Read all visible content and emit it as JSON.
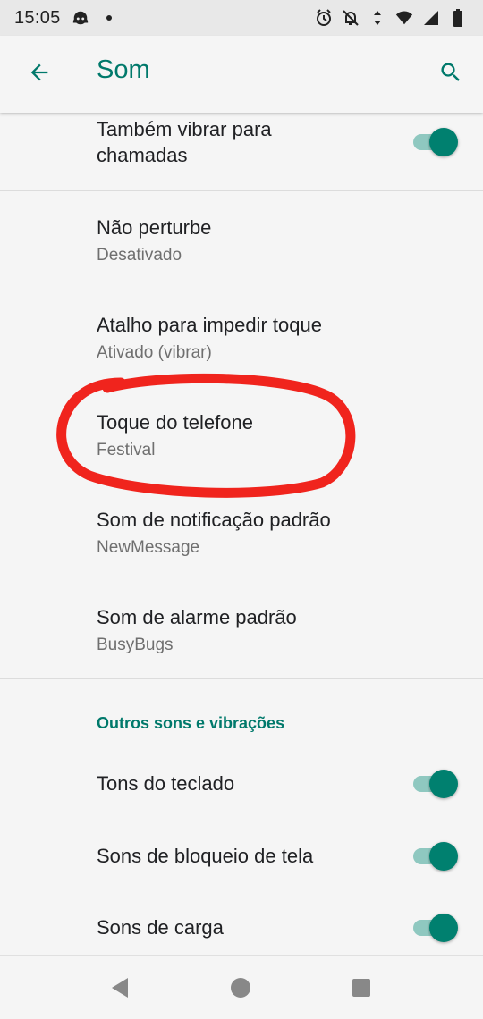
{
  "status_bar": {
    "time": "15:05",
    "icons": [
      "android-head-icon",
      "dot-icon",
      "alarm-icon",
      "notifications-off-icon",
      "data-arrows-icon",
      "wifi-icon",
      "signal-icon",
      "battery-icon"
    ]
  },
  "app_bar": {
    "title": "Som",
    "back_icon": "arrow-left-icon",
    "search_icon": "search-icon"
  },
  "settings": {
    "vibrate_calls": {
      "title_line1": "Também vibrar para",
      "title_line2": "chamadas",
      "enabled": true
    },
    "dnd": {
      "title": "Não perturbe",
      "subtitle": "Desativado"
    },
    "ring_shortcut": {
      "title": "Atalho para impedir toque",
      "subtitle": "Ativado (vibrar)"
    },
    "ringtone": {
      "title": "Toque do telefone",
      "subtitle": "Festival"
    },
    "notification_sound": {
      "title": "Som de notificação padrão",
      "subtitle": "NewMessage"
    },
    "alarm_sound": {
      "title": "Som de alarme padrão",
      "subtitle": "BusyBugs"
    }
  },
  "other_section": {
    "header": "Outros sons e vibrações",
    "items": [
      {
        "title": "Tons do teclado",
        "enabled": true
      },
      {
        "title": "Sons de bloqueio de tela",
        "enabled": true
      },
      {
        "title": "Sons de carga",
        "enabled": true
      }
    ]
  },
  "colors": {
    "accent": "#00796b",
    "toggle_thumb": "#00806f",
    "toggle_track": "#8fc8c0",
    "annotation": "#f0241d",
    "background": "#f5f5f5"
  },
  "nav_bar": {
    "back_icon": "nav-back-triangle-icon",
    "home_icon": "nav-home-circle-icon",
    "recents_icon": "nav-recents-square-icon"
  }
}
